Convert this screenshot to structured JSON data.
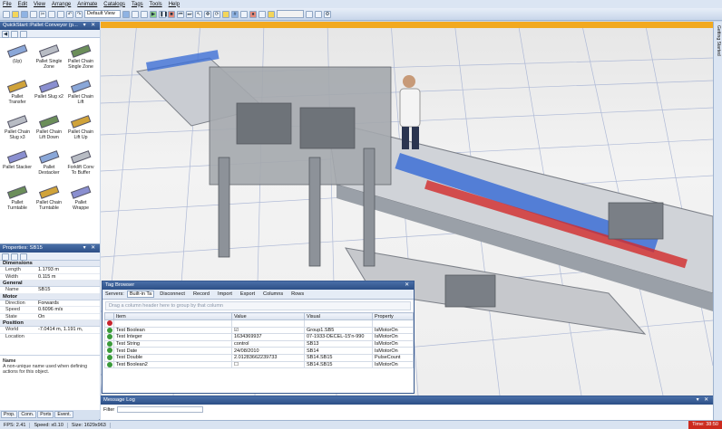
{
  "menu": [
    "File",
    "Edit",
    "View",
    "Arrange",
    "Animate",
    "Catalogs",
    "Tags",
    "Tools",
    "Help"
  ],
  "toolbar": {
    "view_combo": "Default View"
  },
  "left": {
    "quickstart_title": "QuickStart::Pallet Conveyor (p...",
    "library": [
      {
        "label": "(Up)",
        "icon": "up-arrow-icon"
      },
      {
        "label": "Pallet Single Zone",
        "icon": "conveyor-icon"
      },
      {
        "label": "Pallet Chain Single Zone",
        "icon": "chain-conveyor-icon"
      },
      {
        "label": "Pallet Transfer",
        "icon": "transfer-icon"
      },
      {
        "label": "Pallet Slug x2",
        "icon": "slug-icon"
      },
      {
        "label": "Pallet Chain Lift",
        "icon": "lift-icon"
      },
      {
        "label": "Pallet Chain Slug x3",
        "icon": "chain-slug-icon"
      },
      {
        "label": "Pallet Chain Lift Down",
        "icon": "lift-down-icon"
      },
      {
        "label": "Pallet Chain Lift Up",
        "icon": "lift-up-icon"
      },
      {
        "label": "Pallet Stacker",
        "icon": "stacker-icon"
      },
      {
        "label": "Pallet Destacker",
        "icon": "destacker-icon"
      },
      {
        "label": "Forklift Conv To Buffer",
        "icon": "forklift-icon"
      },
      {
        "label": "Pallet Turntable",
        "icon": "turntable-icon"
      },
      {
        "label": "Pallet Chain Turntable",
        "icon": "chain-turntable-icon"
      },
      {
        "label": "Pallet Wrappe",
        "icon": "wrapper-icon"
      }
    ],
    "properties_title": "Properties: SB15",
    "properties": [
      {
        "section": "Dimensions",
        "rows": [
          {
            "k": "Length",
            "v": "1.1793 m"
          },
          {
            "k": "Width",
            "v": "0.115 m"
          }
        ]
      },
      {
        "section": "General",
        "rows": [
          {
            "k": "Name",
            "v": "SB15"
          }
        ]
      },
      {
        "section": "Motor",
        "rows": [
          {
            "k": "Direction",
            "v": "Forwards"
          },
          {
            "k": "Speed",
            "v": "0.6096 m/s"
          },
          {
            "k": "State",
            "v": "On"
          }
        ]
      },
      {
        "section": "Position",
        "rows": [
          {
            "k": "World Location",
            "v": "-7.0414 m, 1.191 m,"
          }
        ]
      }
    ],
    "desc_title": "Name",
    "desc_text": "A non-unique name used when defining actions for this object.",
    "tabs": [
      "Prop.",
      "Conn.",
      "Ports",
      "Event."
    ]
  },
  "viewport": {
    "side_label": "Getting Started"
  },
  "tag_browser": {
    "title": "Tag Browser",
    "servers_label": "Servers:",
    "server_value": "Built-in Ta",
    "buttons": [
      "Disconnect",
      "Record",
      "Import",
      "Export",
      "Columns",
      "Rows"
    ],
    "group_hint": "Drag a column header here to group by that column",
    "columns": [
      "Item",
      "Value",
      "Visual",
      "Property"
    ],
    "rows": [
      {
        "item": "Test Boolean",
        "value": "☑",
        "visual": "Group1.SB5",
        "property": "IsMotorOn"
      },
      {
        "item": "Test Integer",
        "value": "1634369937",
        "visual": "07-1933-DECEL-15'n-990",
        "property": "IsMotorOn"
      },
      {
        "item": "Test String",
        "value": "control",
        "visual": "SB13",
        "property": "IsMotorOn"
      },
      {
        "item": "Test Date",
        "value": "24/08/2010",
        "visual": "SB14",
        "property": "IsMotorOn"
      },
      {
        "item": "Test Double",
        "value": "2.01283662239733",
        "visual": "SB14.SB15",
        "property": "PulseCount"
      },
      {
        "item": "Test Boolean2",
        "value": "☐",
        "visual": "SB14.SB15",
        "property": "IsMotorOn"
      }
    ]
  },
  "message_log": {
    "title": "Message Log",
    "filter_label": "Filter"
  },
  "status": {
    "fps": "FPS: 2.41",
    "speed": "Speed: x0.10",
    "size": "Size: 1629x963",
    "time": "Time: 38:50"
  },
  "colors": {
    "accent": "#f2a91f",
    "panel_header": "#2c4f86",
    "time_bg": "#cc2a1e"
  }
}
